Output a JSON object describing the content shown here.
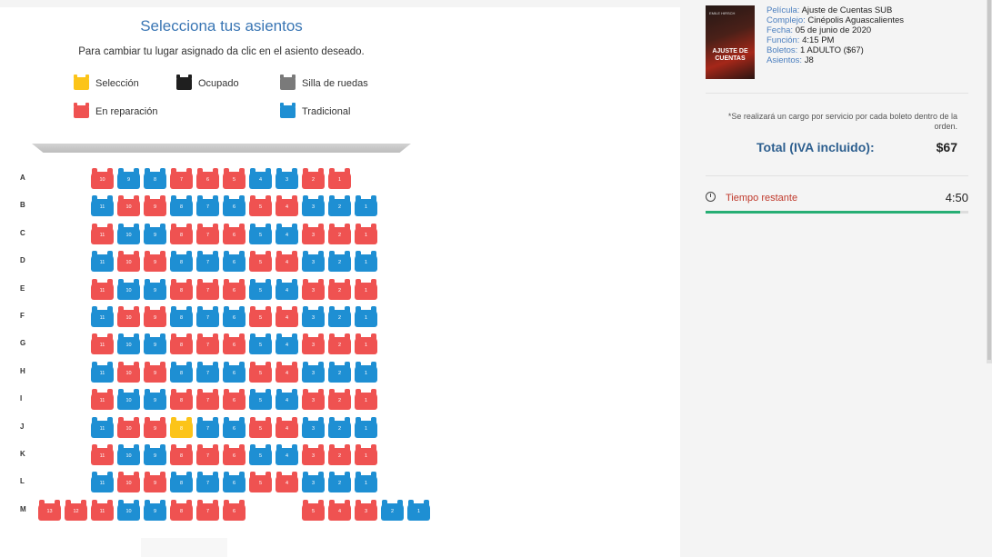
{
  "header": {
    "title": "Selecciona tus asientos",
    "subtitle": "Para cambiar tu lugar asignado da clic en el asiento deseado."
  },
  "legend": [
    {
      "key": "seleccion",
      "label": "Selección",
      "color": "#fcc419"
    },
    {
      "key": "ocupado",
      "label": "Ocupado",
      "color": "#1f1f1f"
    },
    {
      "key": "silla",
      "label": "Silla de ruedas",
      "color": "#7a7a7a"
    },
    {
      "key": "reparacion",
      "label": "En reparación",
      "color": "#ef5251"
    },
    {
      "key": "tradicional",
      "label": "Tradicional",
      "color": "#1e8fd3"
    }
  ],
  "colors": {
    "red": "#ef5251",
    "blue": "#1e8fd3",
    "yellow": "#fcc419"
  },
  "seatmap": {
    "rows": [
      {
        "letter": "A",
        "seats": [
          {
            "n": "10",
            "s": "r"
          },
          {
            "n": "9",
            "s": "b"
          },
          {
            "n": "8",
            "s": "b"
          },
          {
            "n": "7",
            "s": "r"
          },
          {
            "n": "6",
            "s": "r"
          },
          {
            "n": "5",
            "s": "r"
          },
          {
            "n": "4",
            "s": "b"
          },
          {
            "n": "3",
            "s": "b"
          },
          {
            "n": "2",
            "s": "r"
          },
          {
            "n": "1",
            "s": "r"
          }
        ]
      },
      {
        "letter": "B",
        "seats": [
          {
            "n": "11",
            "s": "b"
          },
          {
            "n": "10",
            "s": "r"
          },
          {
            "n": "9",
            "s": "r"
          },
          {
            "n": "8",
            "s": "b"
          },
          {
            "n": "7",
            "s": "b"
          },
          {
            "n": "6",
            "s": "b"
          },
          {
            "n": "5",
            "s": "r"
          },
          {
            "n": "4",
            "s": "r"
          },
          {
            "n": "3",
            "s": "b"
          },
          {
            "n": "2",
            "s": "b"
          },
          {
            "n": "1",
            "s": "b"
          }
        ]
      },
      {
        "letter": "C",
        "seats": [
          {
            "n": "11",
            "s": "r"
          },
          {
            "n": "10",
            "s": "b"
          },
          {
            "n": "9",
            "s": "b"
          },
          {
            "n": "8",
            "s": "r"
          },
          {
            "n": "7",
            "s": "r"
          },
          {
            "n": "6",
            "s": "r"
          },
          {
            "n": "5",
            "s": "b"
          },
          {
            "n": "4",
            "s": "b"
          },
          {
            "n": "3",
            "s": "r"
          },
          {
            "n": "2",
            "s": "r"
          },
          {
            "n": "1",
            "s": "r"
          }
        ]
      },
      {
        "letter": "D",
        "seats": [
          {
            "n": "11",
            "s": "b"
          },
          {
            "n": "10",
            "s": "r"
          },
          {
            "n": "9",
            "s": "r"
          },
          {
            "n": "8",
            "s": "b"
          },
          {
            "n": "7",
            "s": "b"
          },
          {
            "n": "6",
            "s": "b"
          },
          {
            "n": "5",
            "s": "r"
          },
          {
            "n": "4",
            "s": "r"
          },
          {
            "n": "3",
            "s": "b"
          },
          {
            "n": "2",
            "s": "b"
          },
          {
            "n": "1",
            "s": "b"
          }
        ]
      },
      {
        "letter": "E",
        "seats": [
          {
            "n": "11",
            "s": "r"
          },
          {
            "n": "10",
            "s": "b"
          },
          {
            "n": "9",
            "s": "b"
          },
          {
            "n": "8",
            "s": "r"
          },
          {
            "n": "7",
            "s": "r"
          },
          {
            "n": "6",
            "s": "r"
          },
          {
            "n": "5",
            "s": "b"
          },
          {
            "n": "4",
            "s": "b"
          },
          {
            "n": "3",
            "s": "r"
          },
          {
            "n": "2",
            "s": "r"
          },
          {
            "n": "1",
            "s": "r"
          }
        ]
      },
      {
        "letter": "F",
        "seats": [
          {
            "n": "11",
            "s": "b"
          },
          {
            "n": "10",
            "s": "r"
          },
          {
            "n": "9",
            "s": "r"
          },
          {
            "n": "8",
            "s": "b"
          },
          {
            "n": "7",
            "s": "b"
          },
          {
            "n": "6",
            "s": "b"
          },
          {
            "n": "5",
            "s": "r"
          },
          {
            "n": "4",
            "s": "r"
          },
          {
            "n": "3",
            "s": "b"
          },
          {
            "n": "2",
            "s": "b"
          },
          {
            "n": "1",
            "s": "b"
          }
        ]
      },
      {
        "letter": "G",
        "seats": [
          {
            "n": "11",
            "s": "r"
          },
          {
            "n": "10",
            "s": "b"
          },
          {
            "n": "9",
            "s": "b"
          },
          {
            "n": "8",
            "s": "r"
          },
          {
            "n": "7",
            "s": "r"
          },
          {
            "n": "6",
            "s": "r"
          },
          {
            "n": "5",
            "s": "b"
          },
          {
            "n": "4",
            "s": "b"
          },
          {
            "n": "3",
            "s": "r"
          },
          {
            "n": "2",
            "s": "r"
          },
          {
            "n": "1",
            "s": "r"
          }
        ]
      },
      {
        "letter": "H",
        "seats": [
          {
            "n": "11",
            "s": "b"
          },
          {
            "n": "10",
            "s": "r"
          },
          {
            "n": "9",
            "s": "r"
          },
          {
            "n": "8",
            "s": "b"
          },
          {
            "n": "7",
            "s": "b"
          },
          {
            "n": "6",
            "s": "b"
          },
          {
            "n": "5",
            "s": "r"
          },
          {
            "n": "4",
            "s": "r"
          },
          {
            "n": "3",
            "s": "b"
          },
          {
            "n": "2",
            "s": "b"
          },
          {
            "n": "1",
            "s": "b"
          }
        ]
      },
      {
        "letter": "I",
        "seats": [
          {
            "n": "11",
            "s": "r"
          },
          {
            "n": "10",
            "s": "b"
          },
          {
            "n": "9",
            "s": "b"
          },
          {
            "n": "8",
            "s": "r"
          },
          {
            "n": "7",
            "s": "r"
          },
          {
            "n": "6",
            "s": "r"
          },
          {
            "n": "5",
            "s": "b"
          },
          {
            "n": "4",
            "s": "b"
          },
          {
            "n": "3",
            "s": "r"
          },
          {
            "n": "2",
            "s": "r"
          },
          {
            "n": "1",
            "s": "r"
          }
        ]
      },
      {
        "letter": "J",
        "seats": [
          {
            "n": "11",
            "s": "b"
          },
          {
            "n": "10",
            "s": "r"
          },
          {
            "n": "9",
            "s": "r"
          },
          {
            "n": "8",
            "s": "y"
          },
          {
            "n": "7",
            "s": "b"
          },
          {
            "n": "6",
            "s": "b"
          },
          {
            "n": "5",
            "s": "r"
          },
          {
            "n": "4",
            "s": "r"
          },
          {
            "n": "3",
            "s": "b"
          },
          {
            "n": "2",
            "s": "b"
          },
          {
            "n": "1",
            "s": "b"
          }
        ]
      },
      {
        "letter": "K",
        "seats": [
          {
            "n": "11",
            "s": "r"
          },
          {
            "n": "10",
            "s": "b"
          },
          {
            "n": "9",
            "s": "b"
          },
          {
            "n": "8",
            "s": "r"
          },
          {
            "n": "7",
            "s": "r"
          },
          {
            "n": "6",
            "s": "r"
          },
          {
            "n": "5",
            "s": "b"
          },
          {
            "n": "4",
            "s": "b"
          },
          {
            "n": "3",
            "s": "r"
          },
          {
            "n": "2",
            "s": "r"
          },
          {
            "n": "1",
            "s": "r"
          }
        ]
      },
      {
        "letter": "L",
        "seats": [
          {
            "n": "11",
            "s": "b"
          },
          {
            "n": "10",
            "s": "r"
          },
          {
            "n": "9",
            "s": "r"
          },
          {
            "n": "8",
            "s": "b"
          },
          {
            "n": "7",
            "s": "b"
          },
          {
            "n": "6",
            "s": "b"
          },
          {
            "n": "5",
            "s": "r"
          },
          {
            "n": "4",
            "s": "r"
          },
          {
            "n": "3",
            "s": "b"
          },
          {
            "n": "2",
            "s": "b"
          },
          {
            "n": "1",
            "s": "b"
          }
        ]
      },
      {
        "letter": "M",
        "seats": [
          {
            "n": "13",
            "s": "r"
          },
          {
            "n": "12",
            "s": "r"
          },
          {
            "n": "11",
            "s": "r"
          },
          {
            "n": "10",
            "s": "b"
          },
          {
            "n": "9",
            "s": "b"
          },
          {
            "n": "8",
            "s": "r"
          },
          {
            "n": "7",
            "s": "r"
          },
          {
            "n": "6",
            "s": "r"
          },
          {
            "n": "5",
            "s": "r"
          },
          {
            "n": "4",
            "s": "r"
          },
          {
            "n": "3",
            "s": "r"
          },
          {
            "n": "2",
            "s": "b"
          },
          {
            "n": "1",
            "s": "b"
          }
        ]
      }
    ]
  },
  "summary": {
    "poster_title": "AJUSTE DE CUENTAS",
    "poster_credit": "EMILE HIRSCH",
    "pelicula_label": "Película:",
    "pelicula": "Ajuste de Cuentas SUB",
    "complejo_label": "Complejo:",
    "complejo": "Cinépolis Aguascalientes",
    "fecha_label": "Fecha:",
    "fecha": "05 de junio de 2020",
    "funcion_label": "Función:",
    "funcion": "4:15 PM",
    "boletos_label": "Boletos:",
    "boletos": "1 ADULTO ($67)",
    "asientos_label": "Asientos:",
    "asientos": "J8",
    "note": "*Se realizará un cargo por servicio por cada boleto dentro de la orden.",
    "total_label": "Total (IVA incluido):",
    "total_value": "$67",
    "timer_label": "Tiempo restante",
    "timer_value": "4:50",
    "timer_progress": 0.97
  }
}
